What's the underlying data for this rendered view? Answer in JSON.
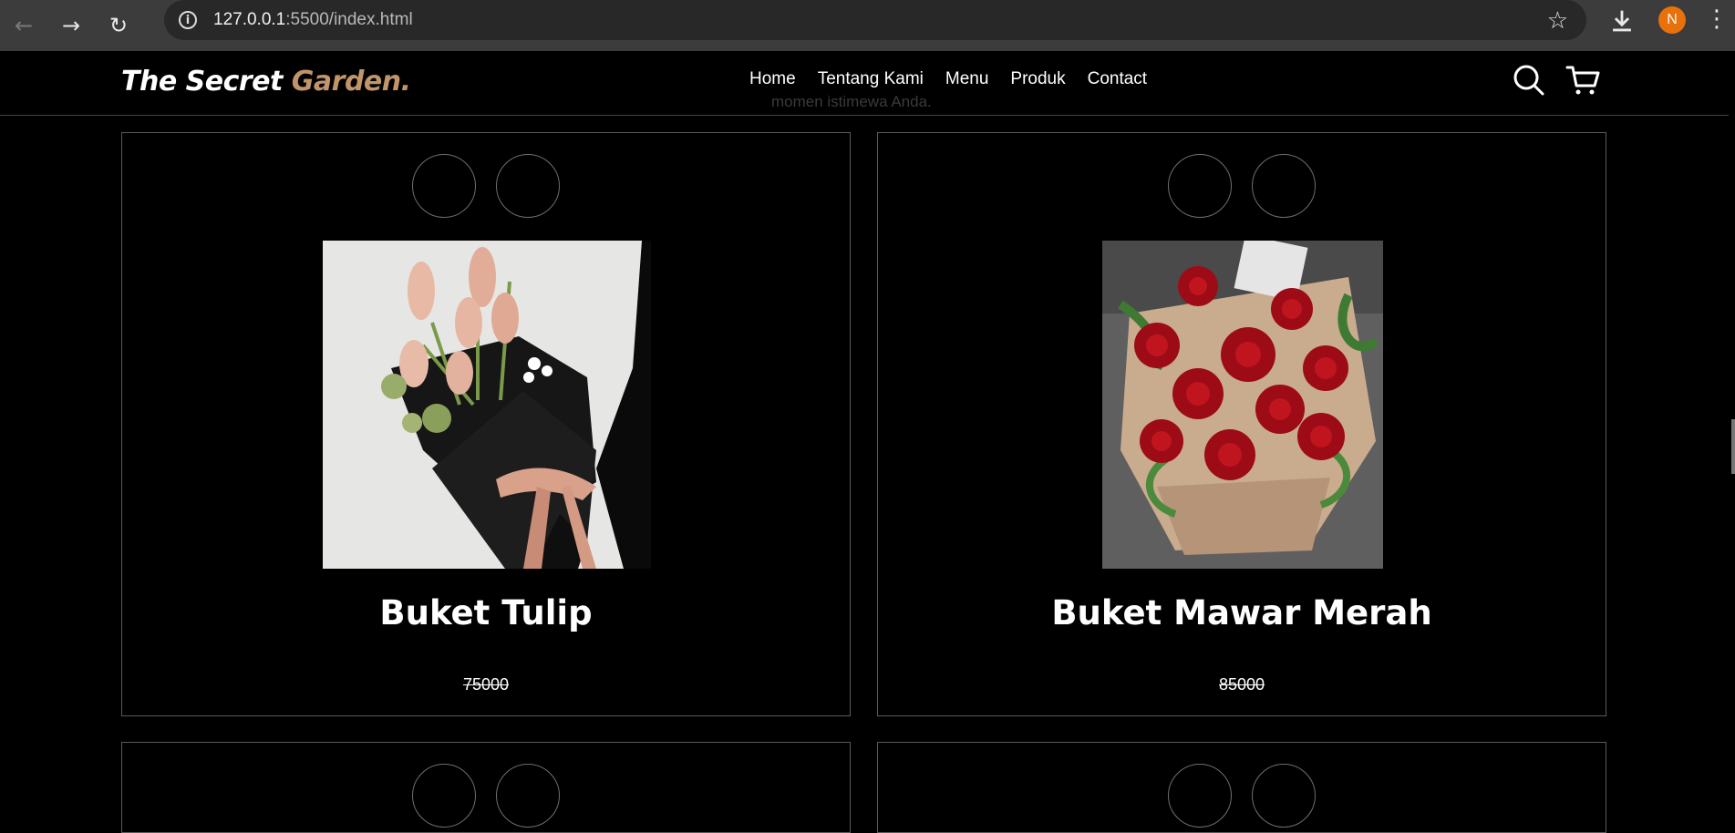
{
  "browser": {
    "url_host": "127.0.0.1",
    "url_path": ":5500/index.html",
    "profile_initial": "N",
    "profile_color": "#e8710a",
    "icons": [
      "back-icon",
      "forward-icon",
      "reload-icon",
      "info-icon",
      "star-icon",
      "download-icon",
      "menu-kebab-icon"
    ]
  },
  "header": {
    "ghost_text": "momen istimewa Anda.",
    "logo_main": "The Secret ",
    "logo_accent": "Garden.",
    "accent_color": "#c0956a",
    "nav": [
      "Home",
      "Tentang Kami",
      "Menu",
      "Produk",
      "Contact"
    ],
    "icons": [
      "search-icon",
      "cart-icon"
    ]
  },
  "products": [
    {
      "title": "Buket Tulip",
      "price": "75000",
      "image": "tulip-bouquet-image"
    },
    {
      "title": "Buket Mawar Merah",
      "price": "85000",
      "image": "red-rose-bouquet-image"
    }
  ]
}
